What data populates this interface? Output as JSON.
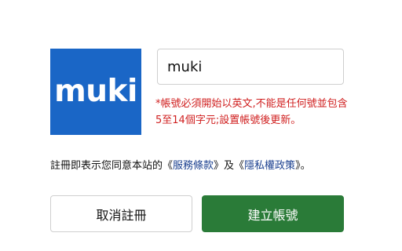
{
  "logo": {
    "text": "muki",
    "color": "#1a66c6"
  },
  "username": {
    "value": "muki"
  },
  "hint": {
    "text": "*帳號必須開始以英文,不能是任何號並包含5至14個字元;設置帳號後更新。",
    "color": "#d02020"
  },
  "terms": {
    "prefix": "註冊即表示您同意本站的《",
    "service_link": "服務條款",
    "middle": "》及《",
    "privacy_link": "隱私權政策",
    "suffix": "》。",
    "link_color": "#1a3f8f"
  },
  "buttons": {
    "cancel_label": "取消註冊",
    "create_label": "建立帳號",
    "create_color": "#2a7b38"
  }
}
